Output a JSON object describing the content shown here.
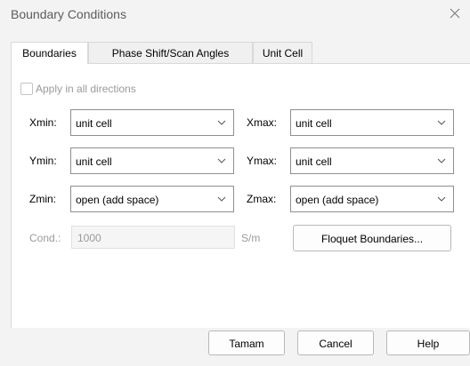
{
  "window": {
    "title": "Boundary Conditions"
  },
  "tabs": [
    {
      "label": "Boundaries",
      "active": true
    },
    {
      "label": "Phase Shift/Scan Angles",
      "active": false
    },
    {
      "label": "Unit Cell",
      "active": false
    }
  ],
  "apply_all": {
    "label": "Apply in all directions",
    "checked": false,
    "enabled": false
  },
  "fields": {
    "xmin": {
      "label": "Xmin:",
      "value": "unit cell"
    },
    "xmax": {
      "label": "Xmax:",
      "value": "unit cell"
    },
    "ymin": {
      "label": "Ymin:",
      "value": "unit cell"
    },
    "ymax": {
      "label": "Ymax:",
      "value": "unit cell"
    },
    "zmin": {
      "label": "Zmin:",
      "value": "open (add space)"
    },
    "zmax": {
      "label": "Zmax:",
      "value": "open (add space)"
    }
  },
  "cond": {
    "label": "Cond.:",
    "value": "1000",
    "unit": "S/m",
    "enabled": false
  },
  "buttons": {
    "floquet": "Floquet Boundaries...",
    "ok": "Tamam",
    "cancel": "Cancel",
    "help": "Help"
  },
  "icons": {
    "close": "close-icon",
    "chevron": "chevron-down-icon"
  }
}
